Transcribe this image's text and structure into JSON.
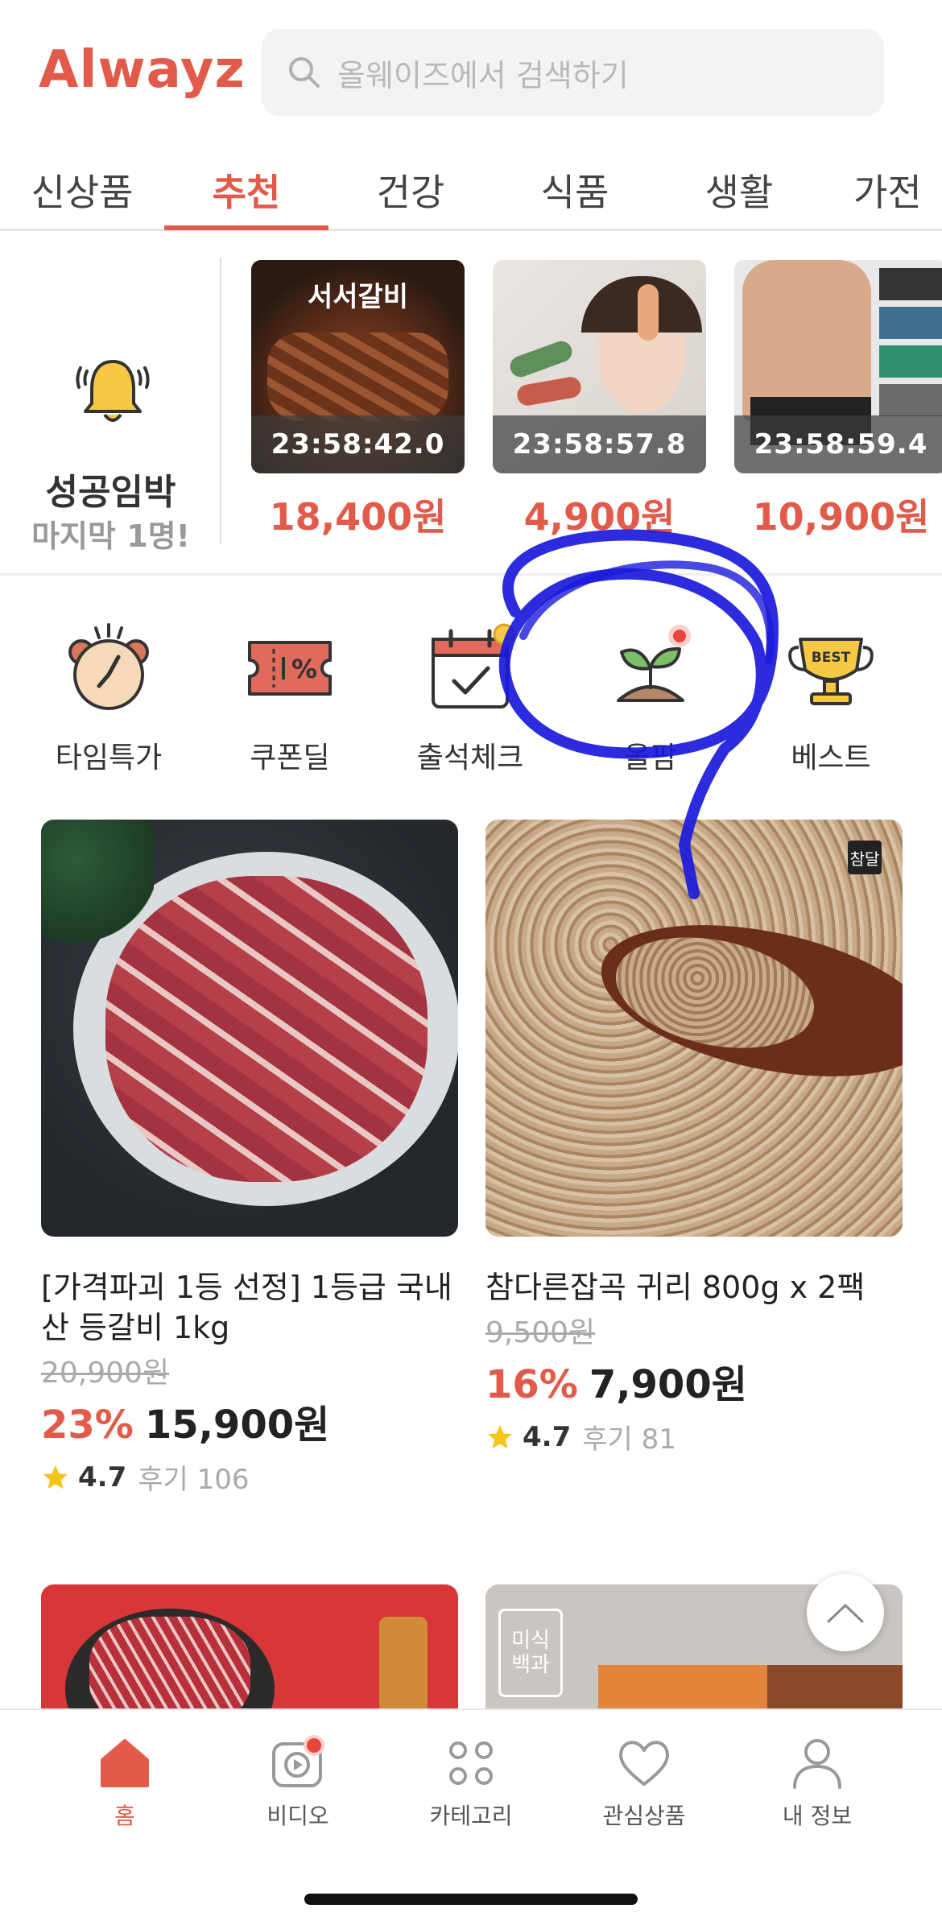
{
  "header": {
    "logo": "Alwayz",
    "search_placeholder": "올웨이즈에서 검색하기"
  },
  "tabs": [
    {
      "label": "신상품",
      "active": false
    },
    {
      "label": "추천",
      "active": true
    },
    {
      "label": "건강",
      "active": false
    },
    {
      "label": "식품",
      "active": false
    },
    {
      "label": "생활",
      "active": false
    },
    {
      "label": "가전",
      "active": false
    }
  ],
  "deal": {
    "title": "성공임박",
    "subtitle": "마지막 1명!",
    "items": [
      {
        "timer": "23:58:42.0",
        "price": "18,400원",
        "image_text": "서서갈비"
      },
      {
        "timer": "23:58:57.8",
        "price": "4,900원"
      },
      {
        "timer": "23:58:59.4",
        "price": "10,900원"
      }
    ]
  },
  "categories": [
    {
      "label": "타임특가",
      "icon": "clock-icon"
    },
    {
      "label": "쿠폰딜",
      "icon": "coupon-icon"
    },
    {
      "label": "출석체크",
      "icon": "calendar-check-icon"
    },
    {
      "label": "올팜",
      "icon": "sprout-icon"
    },
    {
      "label": "베스트",
      "icon": "trophy-icon",
      "badge": "BEST"
    }
  ],
  "products": [
    {
      "title": "[가격파괴 1등 선정] 1등급 국내산 등갈비 1kg",
      "original_price": "20,900원",
      "discount": "23%",
      "price": "15,900원",
      "rating": "4.7",
      "reviews": "후기 106"
    },
    {
      "title": "참다른잡곡 귀리 800g x 2팩",
      "original_price": "9,500원",
      "discount": "16%",
      "price": "7,900원",
      "rating": "4.7",
      "reviews": "후기 81",
      "image_badge": "참달"
    }
  ],
  "bottom_nav": [
    {
      "label": "홈",
      "icon": "home-icon",
      "active": true
    },
    {
      "label": "비디오",
      "icon": "video-icon",
      "active": false
    },
    {
      "label": "카테고리",
      "icon": "category-icon",
      "active": false
    },
    {
      "label": "관심상품",
      "icon": "heart-icon",
      "active": false
    },
    {
      "label": "내 정보",
      "icon": "person-icon",
      "active": false
    }
  ],
  "next_products": [
    {
      "image_text": "미식백과"
    }
  ],
  "colors": {
    "accent": "#e25a4a",
    "annotation": "#1a1adb"
  }
}
